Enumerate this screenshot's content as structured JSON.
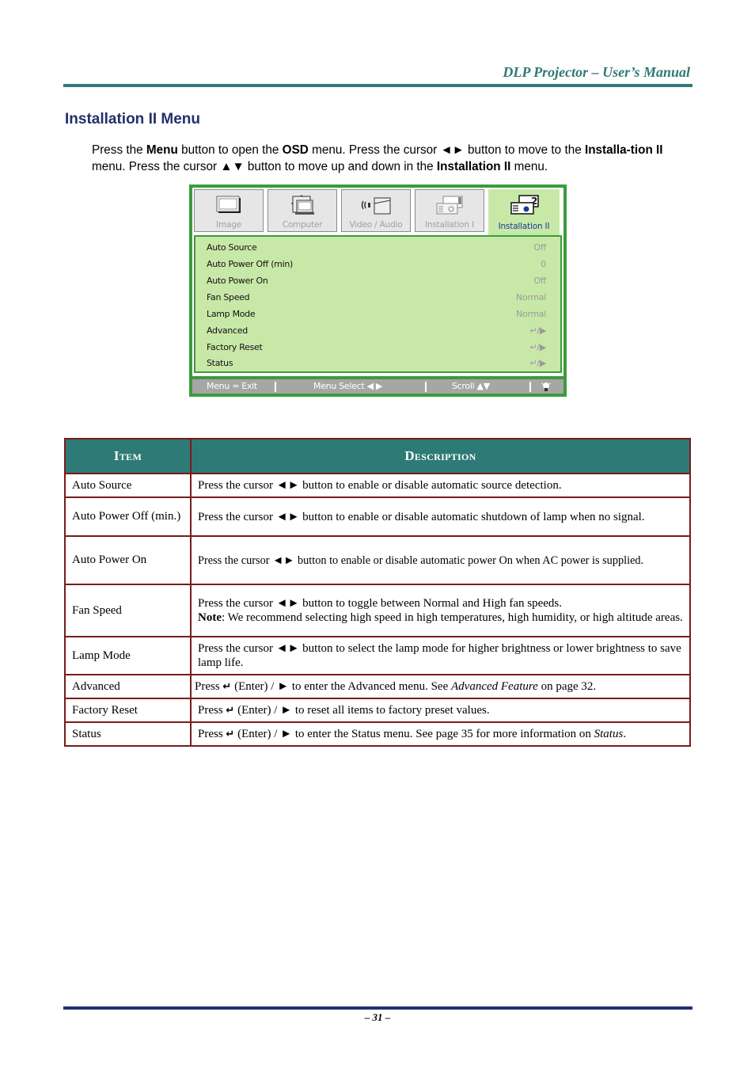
{
  "header": {
    "title": "DLP Projector – User’s Manual"
  },
  "section": {
    "title": "Installation II Menu",
    "intro": {
      "t1": "Press the ",
      "b1": "Menu",
      "t2": " button to open the ",
      "b2": "OSD",
      "t3": " menu. Press the cursor ◄► button to move to the ",
      "b3": "Installa-tion II",
      "t4": " menu. Press the cursor ▲▼ button to move up and down in the ",
      "b4": "Installation II",
      "t5": " menu."
    }
  },
  "osd": {
    "tabs": [
      {
        "label": "Image",
        "icon": "image-icon",
        "active": false
      },
      {
        "label": "Computer",
        "icon": "computer-icon",
        "active": false
      },
      {
        "label": "Video / Audio",
        "icon": "video-audio-icon",
        "active": false
      },
      {
        "label": "Installation I",
        "icon": "installation-1-icon",
        "active": false
      },
      {
        "label": "Installation II",
        "icon": "installation-2-icon",
        "active": true
      }
    ],
    "items": [
      {
        "label": "Auto Source",
        "value": "Off"
      },
      {
        "label": "Auto Power Off (min)",
        "value": "0"
      },
      {
        "label": "Auto Power On",
        "value": "Off"
      },
      {
        "label": "Fan Speed",
        "value": "Normal"
      },
      {
        "label": "Lamp Mode",
        "value": "Normal"
      },
      {
        "label": "Advanced",
        "value": "↵/▶"
      },
      {
        "label": "Factory Reset",
        "value": "↵/▶"
      },
      {
        "label": "Status",
        "value": "↵/▶"
      }
    ],
    "footer": {
      "exit": "Menu = Exit",
      "select": "Menu Select ◀ ▶",
      "scroll": "Scroll ▲▼",
      "icon": "lamp-icon"
    },
    "colors": {
      "frame": "#3c9b3c",
      "panel": "#c8e8a8",
      "footer": "#a6a6a6",
      "active_label": "#1a3a9a"
    }
  },
  "table": {
    "headers": {
      "item": "Item",
      "description": "Description"
    },
    "rows": [
      {
        "item": "Auto Source",
        "desc": "Press the cursor ◄► button to enable or disable automatic source detection."
      },
      {
        "item": "Auto Power Off (min.)",
        "desc": "Press the cursor ◄► button to enable or disable automatic shutdown of lamp when no signal."
      },
      {
        "item": "Auto Power On",
        "desc": "Press the cursor ◄► button to enable or disable automatic power On when AC power is supplied."
      },
      {
        "item": "Fan Speed",
        "desc": "Press the cursor ◄► button to toggle between Normal and High fan speeds.",
        "note_label": "Note",
        "note": ": We recommend selecting high speed in high temperatures, high humidity, or high altitude areas."
      },
      {
        "item": "Lamp Mode",
        "desc": "Press the cursor ◄► button to select the lamp mode for higher brightness or lower brightness to save lamp life."
      },
      {
        "item": "Advanced",
        "pre": "Press ",
        "enter": "↵",
        "mid": " (Enter) / ► to enter the Advanced menu. See ",
        "italic": "Advanced Feature",
        "post": " on page 32."
      },
      {
        "item": "Factory Reset",
        "pre": "Press ",
        "enter": "↵",
        "mid": " (Enter) / ► to reset all items to factory preset values."
      },
      {
        "item": "Status",
        "pre": "Press ",
        "enter": "↵",
        "mid": " (Enter) / ► to enter the Status menu. See page 35 for more information on ",
        "italic": "Status",
        "post": "."
      }
    ],
    "colors": {
      "header_bg": "#2e7a76",
      "border": "#7a1a1a"
    }
  },
  "footer": {
    "page": "– 31 –"
  }
}
